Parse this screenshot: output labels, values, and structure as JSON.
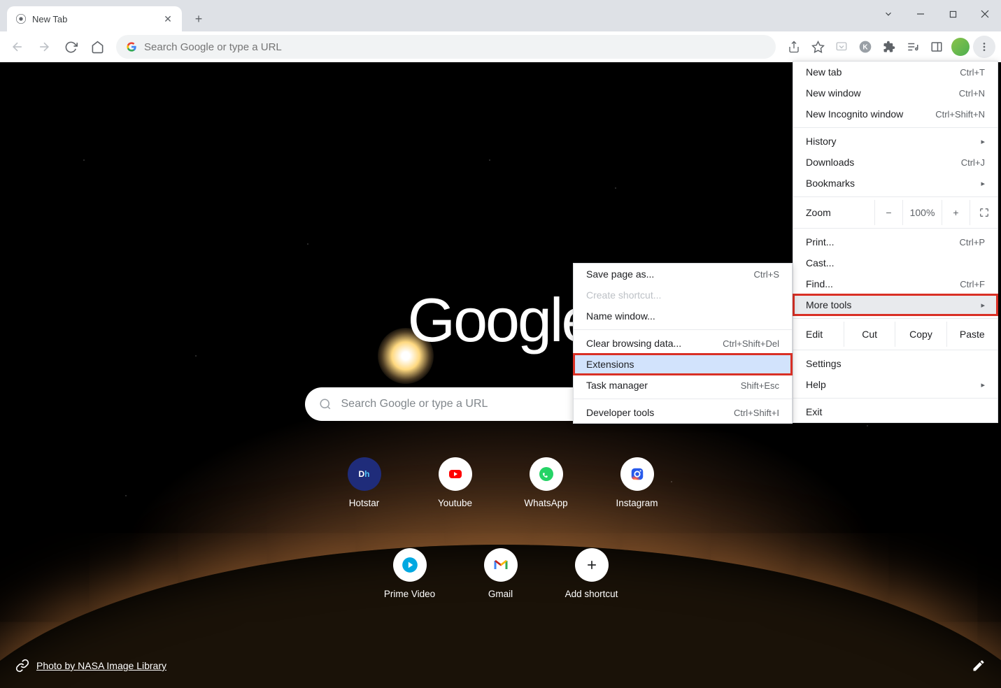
{
  "tab": {
    "title": "New Tab"
  },
  "omnibox": {
    "placeholder": "Search Google or type a URL"
  },
  "search": {
    "placeholder": "Search Google or type a URL"
  },
  "logo": "Google",
  "shortcuts_row1": [
    {
      "label": "Hotstar"
    },
    {
      "label": "Youtube"
    },
    {
      "label": "WhatsApp"
    },
    {
      "label": "Instagram"
    }
  ],
  "shortcuts_row2": [
    {
      "label": "Prime Video"
    },
    {
      "label": "Gmail"
    },
    {
      "label": "Add shortcut"
    }
  ],
  "credit": "Photo by NASA Image Library",
  "menu_main": {
    "new_tab": {
      "label": "New tab",
      "shortcut": "Ctrl+T"
    },
    "new_window": {
      "label": "New window",
      "shortcut": "Ctrl+N"
    },
    "new_incognito": {
      "label": "New Incognito window",
      "shortcut": "Ctrl+Shift+N"
    },
    "history": {
      "label": "History"
    },
    "downloads": {
      "label": "Downloads",
      "shortcut": "Ctrl+J"
    },
    "bookmarks": {
      "label": "Bookmarks"
    },
    "zoom": {
      "label": "Zoom",
      "value": "100%"
    },
    "print": {
      "label": "Print...",
      "shortcut": "Ctrl+P"
    },
    "cast": {
      "label": "Cast..."
    },
    "find": {
      "label": "Find...",
      "shortcut": "Ctrl+F"
    },
    "more_tools": {
      "label": "More tools"
    },
    "edit": {
      "label": "Edit",
      "cut": "Cut",
      "copy": "Copy",
      "paste": "Paste"
    },
    "settings": {
      "label": "Settings"
    },
    "help": {
      "label": "Help"
    },
    "exit": {
      "label": "Exit"
    }
  },
  "menu_sub": {
    "save_page": {
      "label": "Save page as...",
      "shortcut": "Ctrl+S"
    },
    "create_shortcut": {
      "label": "Create shortcut..."
    },
    "name_window": {
      "label": "Name window..."
    },
    "clear_browsing": {
      "label": "Clear browsing data...",
      "shortcut": "Ctrl+Shift+Del"
    },
    "extensions": {
      "label": "Extensions"
    },
    "task_manager": {
      "label": "Task manager",
      "shortcut": "Shift+Esc"
    },
    "dev_tools": {
      "label": "Developer tools",
      "shortcut": "Ctrl+Shift+I"
    }
  }
}
